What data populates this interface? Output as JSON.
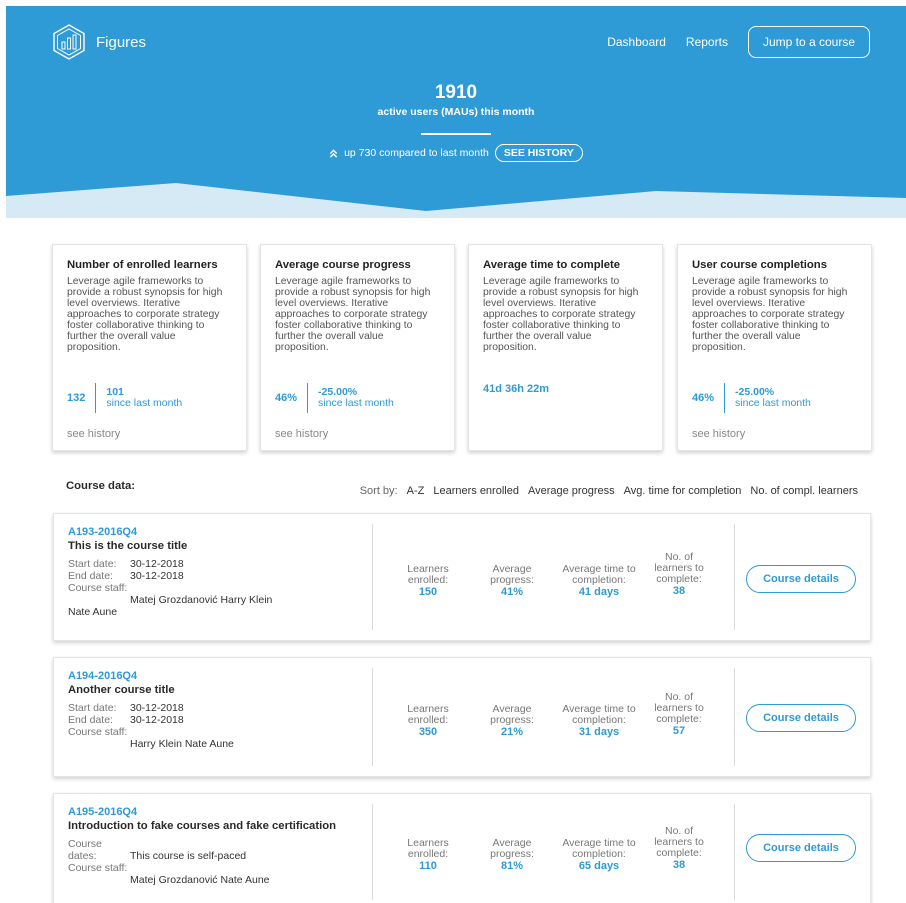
{
  "header": {
    "logo_text": "Figures",
    "nav": [
      "Dashboard",
      "Reports"
    ],
    "jump_label": "Jump to a course"
  },
  "hero": {
    "mau_value": "1910",
    "mau_label": "active users (MAUs) this month",
    "trend_text": "up 730 compared to last month",
    "history_button": "SEE HISTORY"
  },
  "cards": [
    {
      "title": "Number of enrolled learners",
      "description": "Leverage agile frameworks to provide a robust synopsis for high level overviews. Iterative approaches to corporate strategy foster collaborative thinking to further the overall value proposition.",
      "value": "132",
      "delta_value": "101",
      "delta_label": "since last month",
      "history": "see history"
    },
    {
      "title": "Average course progress",
      "description": "Leverage agile frameworks to provide a robust synopsis for high level overviews. Iterative approaches to corporate strategy foster collaborative thinking to further the overall value proposition.",
      "value": "46%",
      "delta_value": "-25.00%",
      "delta_label": "since last month",
      "history": "see history"
    },
    {
      "title": "Average time to complete",
      "description": "Leverage agile frameworks to provide a robust synopsis for high level overviews. Iterative approaches to corporate strategy foster collaborative thinking to further the overall value proposition.",
      "value": "41d 36h 22m"
    },
    {
      "title": "User course completions",
      "description": "Leverage agile frameworks to provide a robust synopsis for high level overviews. Iterative approaches to corporate strategy foster collaborative thinking to further the overall value proposition.",
      "value": "46%",
      "delta_value": "-25.00%",
      "delta_label": "since last month",
      "history": "see history"
    }
  ],
  "course_list": {
    "heading": "Course data:",
    "sort_label": "Sort by:",
    "sort_options": [
      "A-Z",
      "Learners enrolled",
      "Average progress",
      "Avg. time for completion",
      "No. of compl. learners"
    ],
    "metric_labels": {
      "learners": "Learners enrolled:",
      "progress": "Average progress:",
      "time": "Average time to completion:",
      "complete": "No. of learners to complete:"
    },
    "details_label": "Course details",
    "courses": [
      {
        "code": "A193-2016Q4",
        "title": "This is the course title",
        "start_label": "Start date:",
        "start": "30-12-2018",
        "end_label": "End date:",
        "end": "30-12-2018",
        "staff_label": "Course staff:",
        "staff": "Matej Grozdanović  Harry Klein",
        "staff_extra": "Nate Aune",
        "learners": "150",
        "progress": "41%",
        "time": "41 days",
        "complete": "38"
      },
      {
        "code": "A194-2016Q4",
        "title": "Another course title",
        "start_label": "Start date:",
        "start": "30-12-2018",
        "end_label": "End date:",
        "end": "30-12-2018",
        "staff_label": "Course staff:",
        "staff": "Harry Klein  Nate Aune",
        "learners": "350",
        "progress": "21%",
        "time": "31 days",
        "complete": "57"
      },
      {
        "code": "A195-2016Q4",
        "title": "Introduction to fake courses and fake certification",
        "dates_label": "Course dates:",
        "dates": "This course is self-paced",
        "staff_label": "Course staff:",
        "staff": "Matej Grozdanović  Nate Aune",
        "learners": "110",
        "progress": "81%",
        "time": "65 days",
        "complete": "38"
      }
    ]
  },
  "colors": {
    "brand": "#2e9ad6",
    "hero_light": "#d6eaf6"
  }
}
